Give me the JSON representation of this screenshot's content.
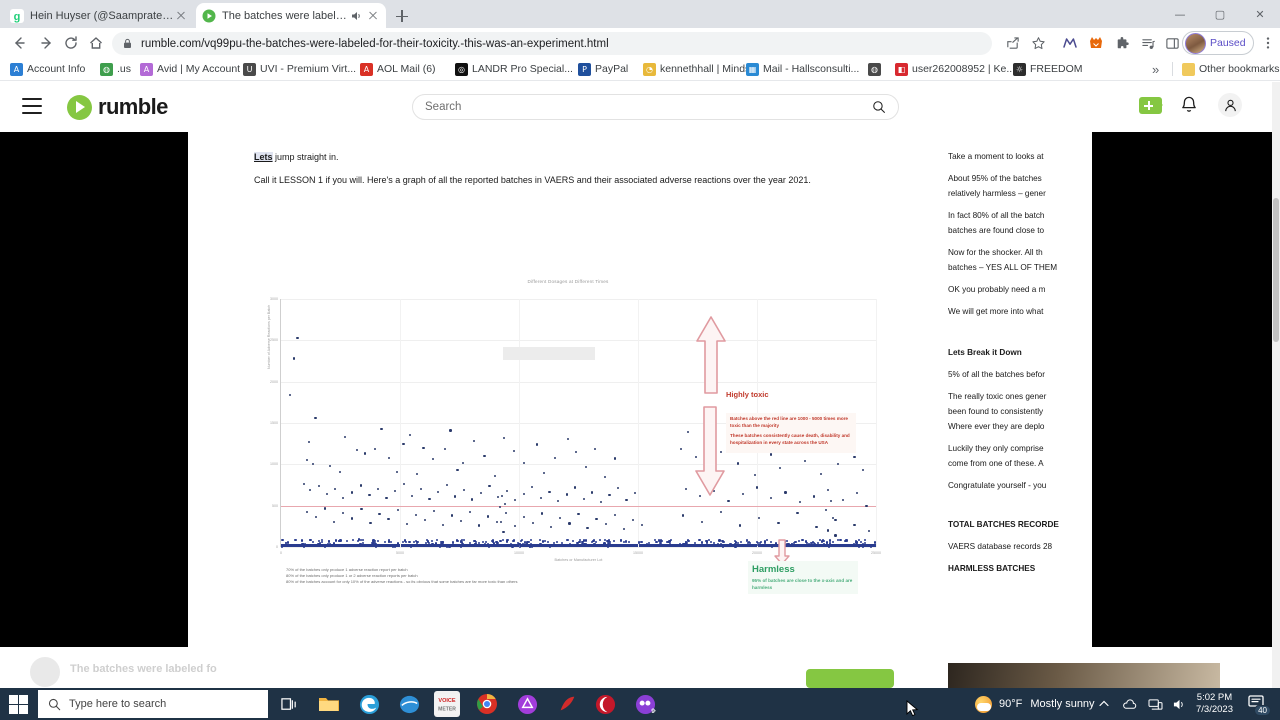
{
  "window": {
    "minimize": "—",
    "maximize": "▢",
    "close": "✕"
  },
  "browser": {
    "tabs": [
      {
        "title": "Hein Huyser (@Saamprater) - Ga",
        "favicon": "g",
        "active": false,
        "audio": false
      },
      {
        "title": "The batches were labeled fo",
        "favicon": "rumble-play-icon",
        "active": true,
        "audio": true
      }
    ],
    "new_tab_label": "+",
    "nav": {
      "back": "←",
      "forward": "→",
      "reload": "⟳",
      "home": "⌂"
    },
    "url": "rumble.com/vq99pu-the-batches-were-labeled-for-their-toxicity.-this-was-an-experiment.html",
    "toolbar_icons": [
      "share-icon",
      "bookmark-star-icon",
      "malwarebytes-icon",
      "firefox-extension-icon",
      "extensions-puzzle-icon",
      "reading-list-icon",
      "side-panel-icon"
    ],
    "profile": {
      "label": "Paused"
    },
    "menu": "⋮",
    "bookmarks": [
      {
        "label": "Account Info",
        "icon": "aol-icon",
        "color": "#2c7fd4"
      },
      {
        "label": ".us",
        "icon": "globe-icon",
        "color": "#3f9e4d"
      },
      {
        "label": "Avid | My Account",
        "icon": "avid-icon",
        "color": "#b36ad6"
      },
      {
        "label": "UVI - Premium Virt...",
        "icon": "uvi-icon",
        "color": "#4a4a4a"
      },
      {
        "label": "AOL Mail (6)",
        "icon": "aol-mail-icon",
        "color": "#d93025"
      },
      {
        "label": "LANDR Pro Special...",
        "icon": "landr-icon",
        "color": "#111111"
      },
      {
        "label": "PayPal",
        "icon": "paypal-icon",
        "color": "#1f4f9c"
      },
      {
        "label": "kennethhall | Minds",
        "icon": "minds-icon",
        "color": "#e8b93b"
      },
      {
        "label": "Mail - Hallsconsulti...",
        "icon": "microsoft-icon",
        "color": "#2a8ad4"
      },
      {
        "label": "",
        "icon": "globe-icon",
        "color": "#4a4a4a"
      },
      {
        "label": "user262008952 | Ke...",
        "icon": "rumble-icon",
        "color": "#d8292f"
      },
      {
        "label": "FREEDOM",
        "icon": "freedom-icon",
        "color": "#2d2d2d"
      }
    ],
    "overflow": "»",
    "other_bookmarks": {
      "label": "Other bookmarks",
      "icon": "folder-icon"
    }
  },
  "rumble": {
    "menu_icon": "hamburger-menu-icon",
    "logo_text": "rumble",
    "search": {
      "placeholder": "Search",
      "icon": "search-icon"
    },
    "upload_icon": "upload-video-icon",
    "bell_icon": "notification-bell-icon",
    "account_icon": "user-account-icon"
  },
  "article": {
    "lines": [
      {
        "lead": "Lets",
        "rest": " jump straight in."
      },
      {
        "lead": "",
        "rest": "Call it LESSON 1 if you will. Here's a graph of all the reported batches in VAERS and their associated adverse reactions over the year 2021."
      }
    ],
    "footnotes": [
      "70% of the batches only produce 1 adverse reaction report per batch",
      "80% of the batches only produce 1 or 2 adverse reaction reports per batch",
      "80% of the batches account for only 10% of the adverse reactions - so its obvious that some batches are far more toxic than others"
    ],
    "right_column": [
      "Take a moment to looks at",
      "About 95% of the batches",
      "relatively harmless – gener",
      "In fact 80% of all the batch",
      "batches are found close to",
      "Now for the shocker. All th",
      "batches – YES ALL OF THEM",
      "OK you probably need a m",
      "We will get more into what",
      "Lets Break it Down",
      "5% of all the batches befor",
      "The really toxic ones gener",
      "been found to consistently",
      "Where ever they are deplo",
      "Luckily they only comprise",
      "come from one of these. A",
      "Congratulate yourself - you",
      "TOTAL BATCHES RECORDE",
      "VAERS database records 28",
      "HARMLESS BATCHES"
    ]
  },
  "chart_data": {
    "type": "scatter",
    "title": "Different Dosages at Different Times",
    "xlabel": "Batches or Manufacturer Lot",
    "ylabel": "Number of Adverse Reactions per Batch",
    "xlim": [
      0,
      25000
    ],
    "ylim": [
      0,
      3000
    ],
    "xticks": [
      "0",
      "5000",
      "10000",
      "15000",
      "20000",
      "25000"
    ],
    "yticks": [
      "3000",
      "2500",
      "2000",
      "1500",
      "1000",
      "500",
      "0"
    ],
    "grid": true,
    "threshold_line": {
      "value": 500,
      "color": "#e8a7ae",
      "label": "red line"
    },
    "baseline_band": {
      "label": "harmless mass of batches close to the x-axis",
      "color": "#2a3c8f"
    },
    "annotations": {
      "toxic_heading": "Highly toxic",
      "toxic_paragraph_1": "Batches above the red line are 1000 - 5000 times more toxic than the majority",
      "toxic_paragraph_2": "These batches consistently cause death, disability and hospitalization in every state across the USA",
      "harmless_heading": "Harmless",
      "harmless_paragraph": "95% of batches are close to the x-axis and are harmless",
      "arrow_up": "upward-arrow-highly-toxic",
      "arrow_down": "downward-arrow-harmless"
    },
    "points": [
      [
        690,
        2530
      ],
      [
        557,
        2280
      ],
      [
        368,
        1840
      ],
      [
        1450,
        1560
      ],
      [
        1160,
        1275
      ],
      [
        1085,
        1055
      ],
      [
        1340,
        1005
      ],
      [
        2700,
        1330
      ],
      [
        3190,
        1175
      ],
      [
        2050,
        980
      ],
      [
        2480,
        905
      ],
      [
        3530,
        1130
      ],
      [
        4220,
        1430
      ],
      [
        3960,
        1190
      ],
      [
        4540,
        1080
      ],
      [
        5150,
        1245
      ],
      [
        4870,
        905
      ],
      [
        5420,
        1355
      ],
      [
        5990,
        1195
      ],
      [
        6380,
        1060
      ],
      [
        5720,
        880
      ],
      [
        7120,
        1410
      ],
      [
        6890,
        1190
      ],
      [
        7650,
        1020
      ],
      [
        8120,
        1280
      ],
      [
        7420,
        935
      ],
      [
        8550,
        1105
      ],
      [
        8980,
        860
      ],
      [
        9360,
        1320
      ],
      [
        9800,
        1160
      ],
      [
        10200,
        1015
      ],
      [
        10750,
        1240
      ],
      [
        11050,
        900
      ],
      [
        11500,
        1080
      ],
      [
        12050,
        1310
      ],
      [
        12400,
        1150
      ],
      [
        12800,
        965
      ],
      [
        13200,
        1190
      ],
      [
        13600,
        845
      ],
      [
        14050,
        1070
      ],
      [
        950,
        760
      ],
      [
        1210,
        690
      ],
      [
        1580,
        735
      ],
      [
        1930,
        640
      ],
      [
        2280,
        700
      ],
      [
        2620,
        590
      ],
      [
        2980,
        660
      ],
      [
        3350,
        745
      ],
      [
        3720,
        625
      ],
      [
        4080,
        705
      ],
      [
        4430,
        590
      ],
      [
        4790,
        680
      ],
      [
        5160,
        760
      ],
      [
        5520,
        620
      ],
      [
        5880,
        700
      ],
      [
        6240,
        585
      ],
      [
        6600,
        665
      ],
      [
        6960,
        750
      ],
      [
        7320,
        610
      ],
      [
        7680,
        690
      ],
      [
        8040,
        575
      ],
      [
        8400,
        655
      ],
      [
        8760,
        740
      ],
      [
        9120,
        600
      ],
      [
        9480,
        680
      ],
      [
        9840,
        565
      ],
      [
        10200,
        645
      ],
      [
        10560,
        730
      ],
      [
        10920,
        590
      ],
      [
        11280,
        670
      ],
      [
        11640,
        555
      ],
      [
        12000,
        635
      ],
      [
        12360,
        720
      ],
      [
        12720,
        580
      ],
      [
        13080,
        660
      ],
      [
        13440,
        545
      ],
      [
        13800,
        625
      ],
      [
        14160,
        710
      ],
      [
        14520,
        570
      ],
      [
        14880,
        650
      ],
      [
        1100,
        420
      ],
      [
        1480,
        360
      ],
      [
        1860,
        465
      ],
      [
        2240,
        300
      ],
      [
        2620,
        410
      ],
      [
        3000,
        345
      ],
      [
        3380,
        455
      ],
      [
        3760,
        290
      ],
      [
        4140,
        400
      ],
      [
        4520,
        335
      ],
      [
        4900,
        445
      ],
      [
        5280,
        280
      ],
      [
        5660,
        390
      ],
      [
        6040,
        325
      ],
      [
        6420,
        435
      ],
      [
        6800,
        270
      ],
      [
        7180,
        380
      ],
      [
        7560,
        315
      ],
      [
        7940,
        425
      ],
      [
        8320,
        260
      ],
      [
        8700,
        370
      ],
      [
        9080,
        305
      ],
      [
        9460,
        415
      ],
      [
        9840,
        250
      ],
      [
        10220,
        360
      ],
      [
        10600,
        295
      ],
      [
        10980,
        405
      ],
      [
        11360,
        240
      ],
      [
        11740,
        350
      ],
      [
        12120,
        285
      ],
      [
        12500,
        395
      ],
      [
        12880,
        230
      ],
      [
        13260,
        340
      ],
      [
        13640,
        275
      ],
      [
        14020,
        385
      ],
      [
        14400,
        220
      ],
      [
        14780,
        330
      ],
      [
        15160,
        265
      ],
      [
        16800,
        1190
      ],
      [
        17100,
        1395
      ],
      [
        17450,
        1085
      ],
      [
        17800,
        1250
      ],
      [
        18150,
        940
      ],
      [
        18500,
        1150
      ],
      [
        18850,
        1330
      ],
      [
        19200,
        1010
      ],
      [
        19550,
        1215
      ],
      [
        19900,
        870
      ],
      [
        20250,
        1290
      ],
      [
        20600,
        1120
      ],
      [
        20950,
        960
      ],
      [
        21300,
        1380
      ],
      [
        21650,
        1180
      ],
      [
        22000,
        1040
      ],
      [
        22350,
        1245
      ],
      [
        22700,
        880
      ],
      [
        23050,
        1160
      ],
      [
        23400,
        1005
      ],
      [
        23750,
        1310
      ],
      [
        24100,
        1090
      ],
      [
        24450,
        930
      ],
      [
        17000,
        700
      ],
      [
        17600,
        620
      ],
      [
        18200,
        680
      ],
      [
        18800,
        560
      ],
      [
        19400,
        640
      ],
      [
        20000,
        720
      ],
      [
        20600,
        590
      ],
      [
        21200,
        660
      ],
      [
        21800,
        540
      ],
      [
        22400,
        610
      ],
      [
        23000,
        690
      ],
      [
        23600,
        570
      ],
      [
        24200,
        650
      ],
      [
        24600,
        500
      ],
      [
        16900,
        380
      ],
      [
        17700,
        300
      ],
      [
        18500,
        420
      ],
      [
        19300,
        260
      ],
      [
        20100,
        350
      ],
      [
        20900,
        290
      ],
      [
        21700,
        410
      ],
      [
        22500,
        240
      ],
      [
        23300,
        330
      ],
      [
        24100,
        270
      ],
      [
        24700,
        190
      ],
      [
        9200,
        480
      ],
      [
        9250,
        300
      ],
      [
        9300,
        620
      ],
      [
        9350,
        180
      ],
      [
        9400,
        520
      ],
      [
        22900,
        450
      ],
      [
        23000,
        200
      ],
      [
        23100,
        560
      ],
      [
        23200,
        350
      ],
      [
        23300,
        140
      ]
    ]
  },
  "taskbar": {
    "start": "windows-start-icon",
    "search_placeholder": "Type here to search",
    "search_icon": "search-icon",
    "apps": [
      {
        "name": "task-view-icon",
        "color": "#ffffff"
      },
      {
        "name": "file-explorer-icon",
        "color": "#f2b441"
      },
      {
        "name": "microsoft-edge-icon",
        "color": "#2b9fd9"
      },
      {
        "name": "blue-app-icon",
        "color": "#2e8fd6"
      },
      {
        "name": "voicemeeter-icon",
        "color": "#cf2121"
      },
      {
        "name": "google-chrome-icon",
        "color": "#d93025"
      },
      {
        "name": "purple-circle-app-icon",
        "color": "#a23ddb"
      },
      {
        "name": "red-arrow-app-icon",
        "color": "#d22b2b"
      },
      {
        "name": "red-moon-app-icon",
        "color": "#c4182a"
      },
      {
        "name": "messenger-app-icon",
        "color": "#8b3fd6"
      }
    ],
    "weather": {
      "temp": "90°F",
      "condition": "Mostly sunny",
      "icon": "partly-sunny-icon"
    },
    "tray": [
      {
        "name": "show-hidden-icons-chevron",
        "glyph": "⌃"
      },
      {
        "name": "onedrive-icon",
        "glyph": "☁"
      },
      {
        "name": "network-icon",
        "glyph": "🖧"
      },
      {
        "name": "volume-icon",
        "glyph": "🔊"
      }
    ],
    "clock": {
      "time": "5:02 PM",
      "date": "7/3/2023"
    },
    "notifications": {
      "icon": "notification-center-icon",
      "count": "40"
    }
  }
}
